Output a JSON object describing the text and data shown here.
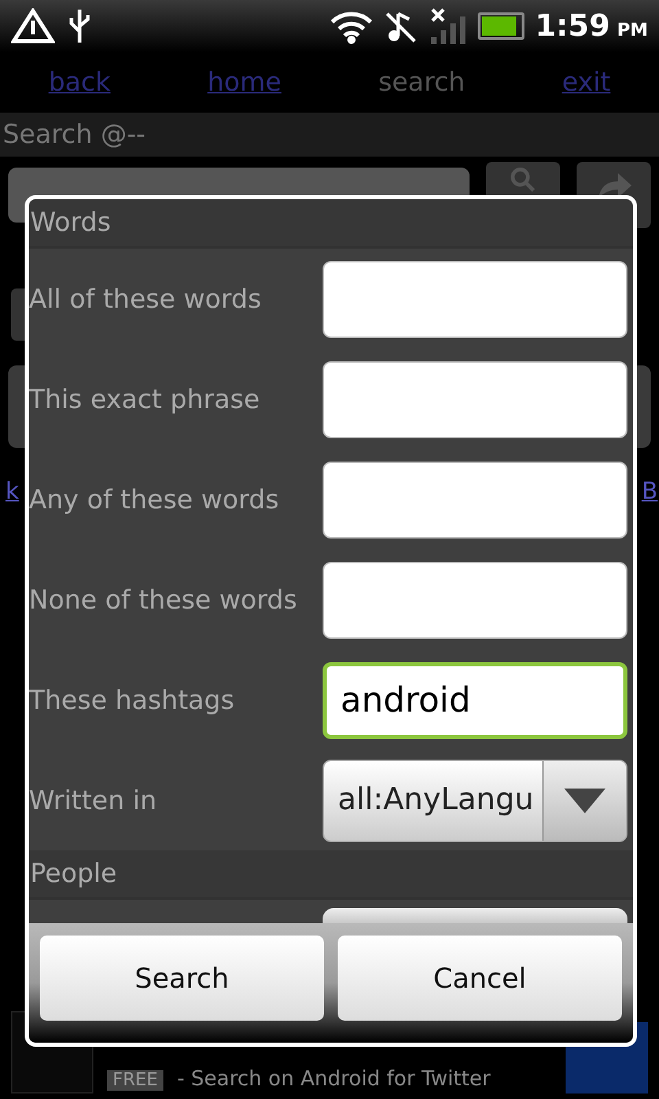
{
  "status_bar": {
    "time": "1:59",
    "ampm": "PM",
    "battery": {
      "level": 0.9
    }
  },
  "nav": [
    {
      "label": "back",
      "disabled": false
    },
    {
      "label": "home",
      "disabled": false
    },
    {
      "label": "search",
      "disabled": true
    },
    {
      "label": "exit",
      "disabled": false
    }
  ],
  "header": {
    "title": "Search @--"
  },
  "background_links": {
    "left": "k",
    "right": "B"
  },
  "ad": {
    "badge": "FREE",
    "text": "- Search on Android for Twitter"
  },
  "dialog": {
    "sections": [
      {
        "title": "Words",
        "rows": [
          {
            "kind": "text",
            "label": "All of these words",
            "value": ""
          },
          {
            "kind": "text",
            "label": "This exact phrase",
            "value": ""
          },
          {
            "kind": "text",
            "label": "Any of these words",
            "value": ""
          },
          {
            "kind": "text",
            "label": "None of these words",
            "value": ""
          },
          {
            "kind": "text",
            "label": "These hashtags",
            "value": "android",
            "focused": true
          },
          {
            "kind": "select",
            "label": "Written in",
            "value": "all:AnyLangu"
          }
        ]
      },
      {
        "title": "People",
        "rows": [
          {
            "kind": "partial"
          }
        ]
      }
    ],
    "buttons": [
      "Search",
      "Cancel"
    ]
  }
}
